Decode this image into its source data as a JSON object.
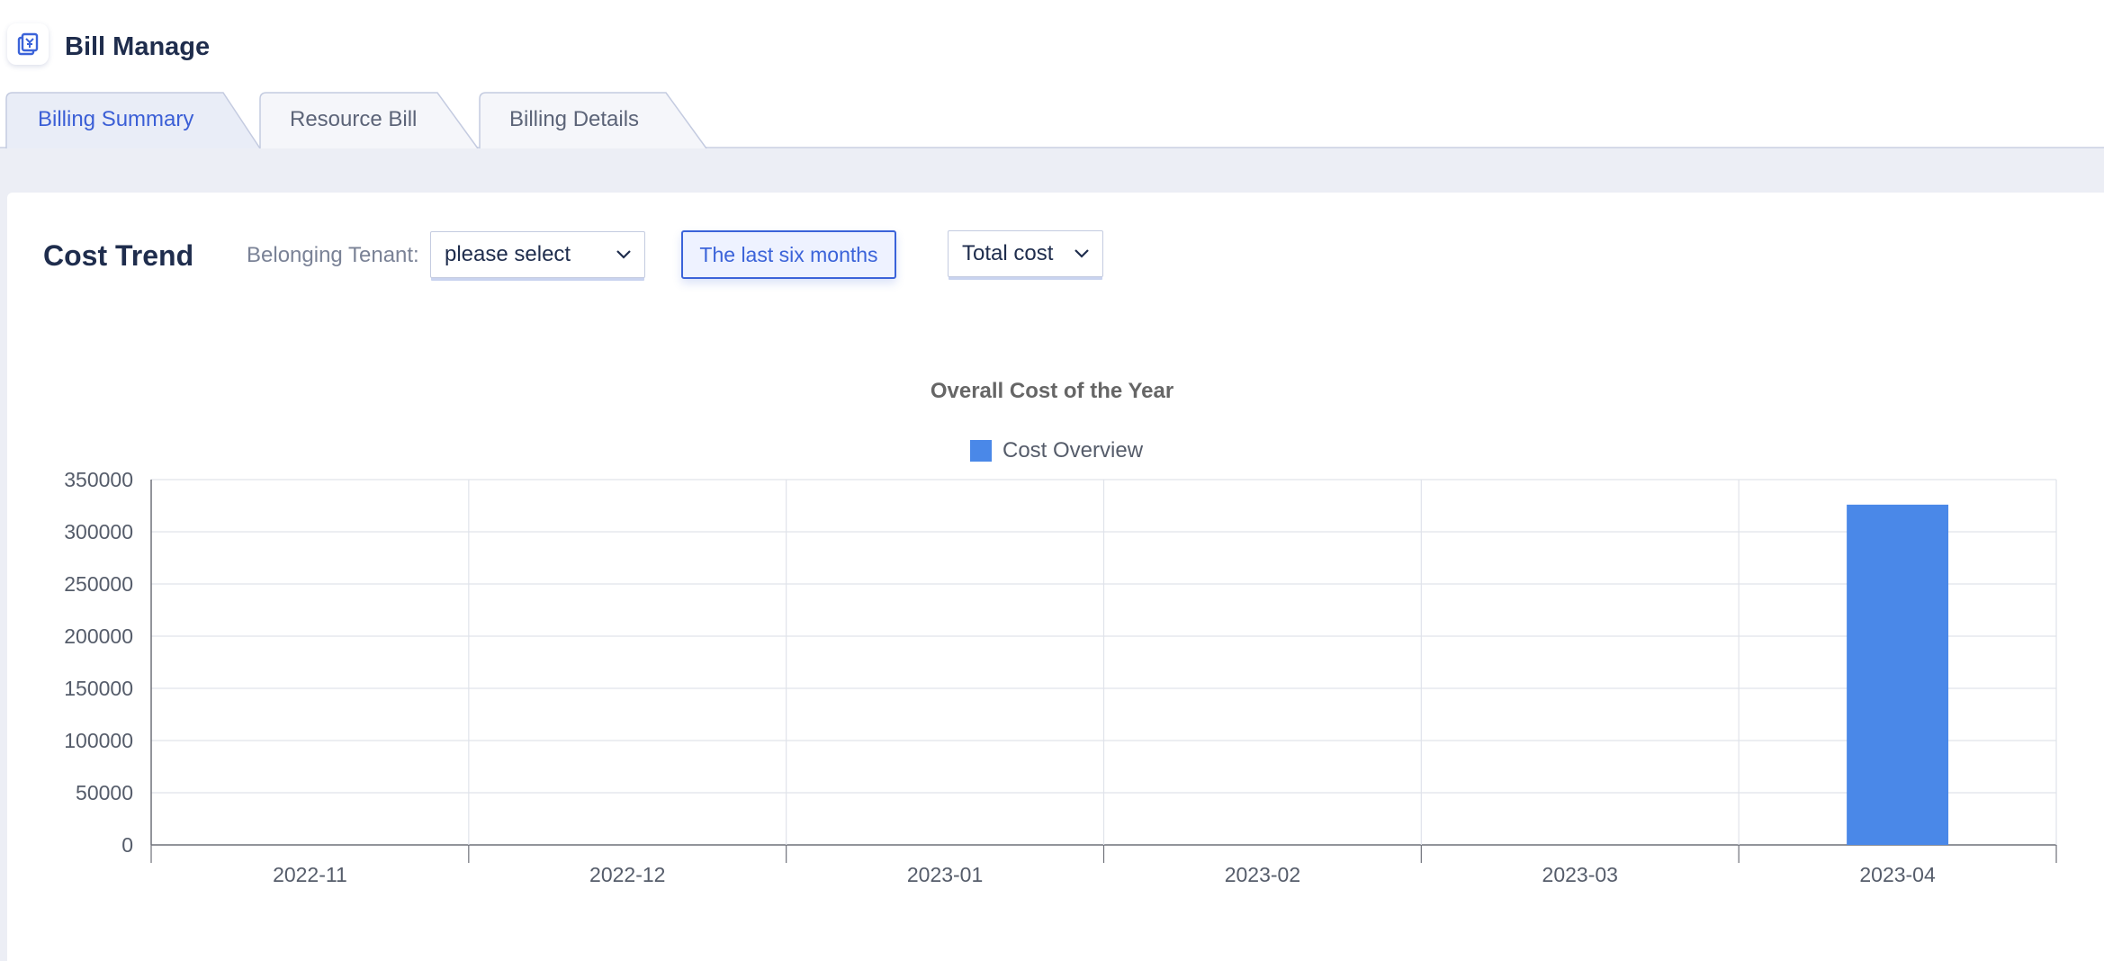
{
  "app": {
    "title": "Bill Manage",
    "icon": "bill-icon"
  },
  "tabs": [
    {
      "label": "Billing Summary",
      "active": true
    },
    {
      "label": "Resource Bill",
      "active": false
    },
    {
      "label": "Billing Details",
      "active": false
    }
  ],
  "section": {
    "title": "Cost Trend",
    "tenant_label": "Belonging Tenant:",
    "tenant_select": "please select",
    "period_button": "The last six months",
    "cost_select": "Total cost"
  },
  "colors": {
    "accent": "#3b63d9",
    "bar": "#4a88e8"
  },
  "chart_data": {
    "type": "bar",
    "title": "Overall Cost of the Year",
    "categories": [
      "2022-11",
      "2022-12",
      "2023-01",
      "2023-02",
      "2023-03",
      "2023-04"
    ],
    "series": [
      {
        "name": "Cost Overview",
        "values": [
          0,
          0,
          0,
          0,
          0,
          326000
        ]
      }
    ],
    "ylim": [
      0,
      350000
    ],
    "yticks": [
      "0",
      "50000",
      "100000",
      "150000",
      "200000",
      "250000",
      "300000",
      "350000"
    ],
    "grid": true,
    "legend": "top-center"
  }
}
